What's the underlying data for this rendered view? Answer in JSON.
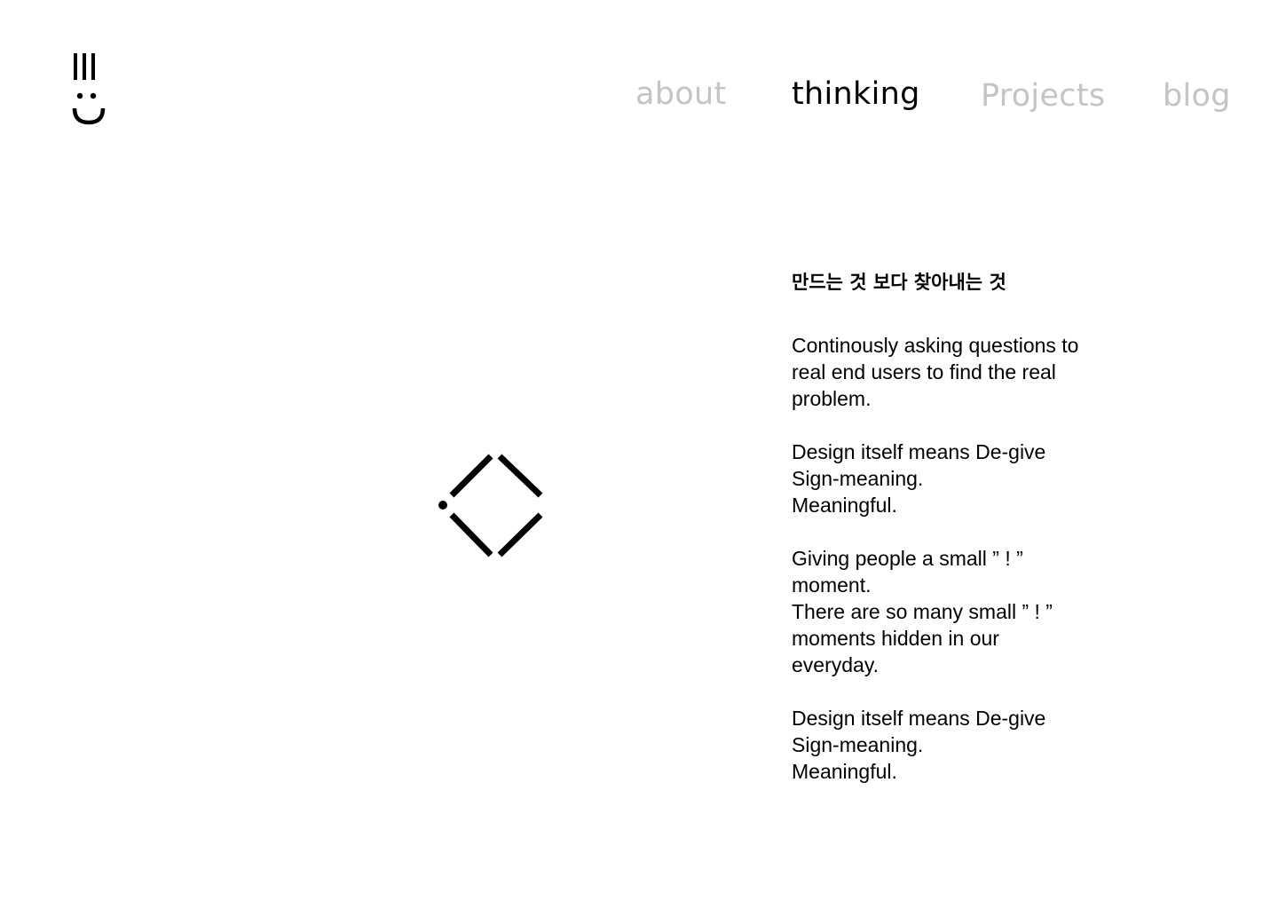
{
  "header": {
    "logo_icon": "smiley-bars-logo-icon"
  },
  "nav": {
    "items": [
      {
        "label": "about",
        "active": false
      },
      {
        "label": "thinking",
        "active": true
      },
      {
        "label": "Projects",
        "active": false
      },
      {
        "label": "blog",
        "active": false
      }
    ]
  },
  "main": {
    "symbol_icon": "dotted-diamond-icon",
    "heading": "만드는 것 보다 찾아내는 것",
    "paragraphs": [
      {
        "lines": [
          "Continously asking questions to",
          "real end users to find the real",
          "problem."
        ]
      },
      {
        "lines": [
          "Design itself means De-give",
          "Sign-meaning.",
          "Meaningful."
        ]
      },
      {
        "lines": [
          "Giving people a small ” ! ”",
          "moment.",
          "There are so many small ” ! ”",
          "moments hidden in our",
          "everyday."
        ]
      },
      {
        "lines": [
          "Design itself means De-give",
          "Sign-meaning.",
          "Meaningful."
        ]
      }
    ]
  },
  "colors": {
    "text": "#000000",
    "nav_inactive": "#c4c4c4",
    "background": "#ffffff"
  }
}
